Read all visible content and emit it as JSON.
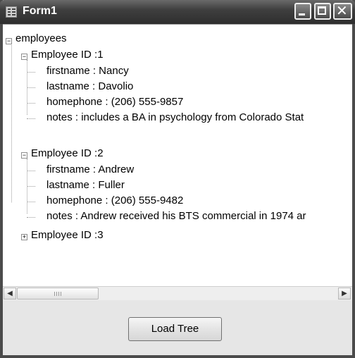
{
  "window": {
    "title": "Form1",
    "icon": "form-icon"
  },
  "titlebar_buttons": {
    "minimize": "minimize-icon",
    "maximize": "maximize-icon",
    "close": "close-icon"
  },
  "tree": {
    "root": "employees",
    "nodes": [
      {
        "label": "Employee ID :1",
        "children": [
          "firstname : Nancy",
          "lastname : Davolio",
          "homephone : (206) 555-9857",
          "notes : includes a BA in psychology from Colorado Stat"
        ]
      },
      {
        "label": "Employee ID :2",
        "children": [
          "firstname : Andrew",
          "lastname : Fuller",
          "homephone : (206) 555-9482",
          "notes : Andrew received his BTS commercial in 1974 ar"
        ]
      },
      {
        "label": "Employee ID :3",
        "children": []
      }
    ]
  },
  "buttons": {
    "load_tree": "Load Tree"
  }
}
